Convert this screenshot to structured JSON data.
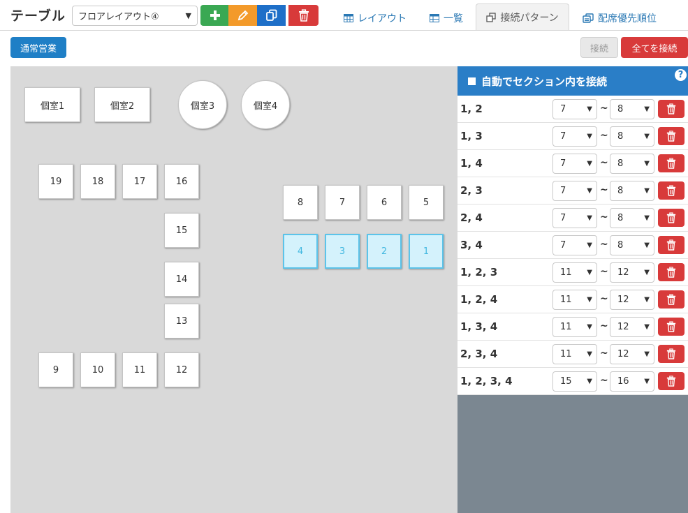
{
  "header": {
    "title": "テーブル",
    "layout_select": "フロアレイアウト④",
    "tabs": [
      {
        "label": "レイアウト"
      },
      {
        "label": "一覧"
      },
      {
        "label": "接続パターン"
      },
      {
        "label": "配席優先順位"
      }
    ]
  },
  "toolbar": {
    "mode_label": "通常営業",
    "connect_label": "接続",
    "connect_all_label": "全てを接続"
  },
  "floor": {
    "rooms": [
      "個室1",
      "個室2",
      "個室3",
      "個室4"
    ],
    "tables": [
      "19",
      "18",
      "17",
      "16",
      "15",
      "14",
      "13",
      "9",
      "10",
      "11",
      "12",
      "8",
      "7",
      "6",
      "5",
      "4",
      "3",
      "2",
      "1"
    ],
    "selected_tables": [
      "4",
      "3",
      "2",
      "1"
    ]
  },
  "panel": {
    "header_label": "自動でセクション内を接続",
    "help_symbol": "?",
    "tilde": "~",
    "rows": [
      {
        "label": "1, 2",
        "from": "7",
        "to": "8"
      },
      {
        "label": "1, 3",
        "from": "7",
        "to": "8"
      },
      {
        "label": "1, 4",
        "from": "7",
        "to": "8"
      },
      {
        "label": "2, 3",
        "from": "7",
        "to": "8"
      },
      {
        "label": "2, 4",
        "from": "7",
        "to": "8"
      },
      {
        "label": "3, 4",
        "from": "7",
        "to": "8"
      },
      {
        "label": "1, 2, 3",
        "from": "11",
        "to": "12"
      },
      {
        "label": "1, 2, 4",
        "from": "11",
        "to": "12"
      },
      {
        "label": "1, 3, 4",
        "from": "11",
        "to": "12"
      },
      {
        "label": "2, 3, 4",
        "from": "11",
        "to": "12"
      },
      {
        "label": "1, 2, 3, 4",
        "from": "15",
        "to": "16"
      }
    ]
  },
  "colors": {
    "primary_blue": "#1f7fc6",
    "danger_red": "#d83a3a",
    "success_green": "#3aa853",
    "warning_orange": "#f39a2a",
    "selected_table_bg": "#d4f2fc",
    "selected_table_border": "#5cc4ea"
  },
  "icons": [
    "plus-icon",
    "pencil-icon",
    "copy-icon",
    "trash-icon",
    "table-grid-icon",
    "list-icon",
    "link-icon",
    "priority-icon",
    "question-icon",
    "checkbox-icon",
    "chevron-down-icon"
  ]
}
